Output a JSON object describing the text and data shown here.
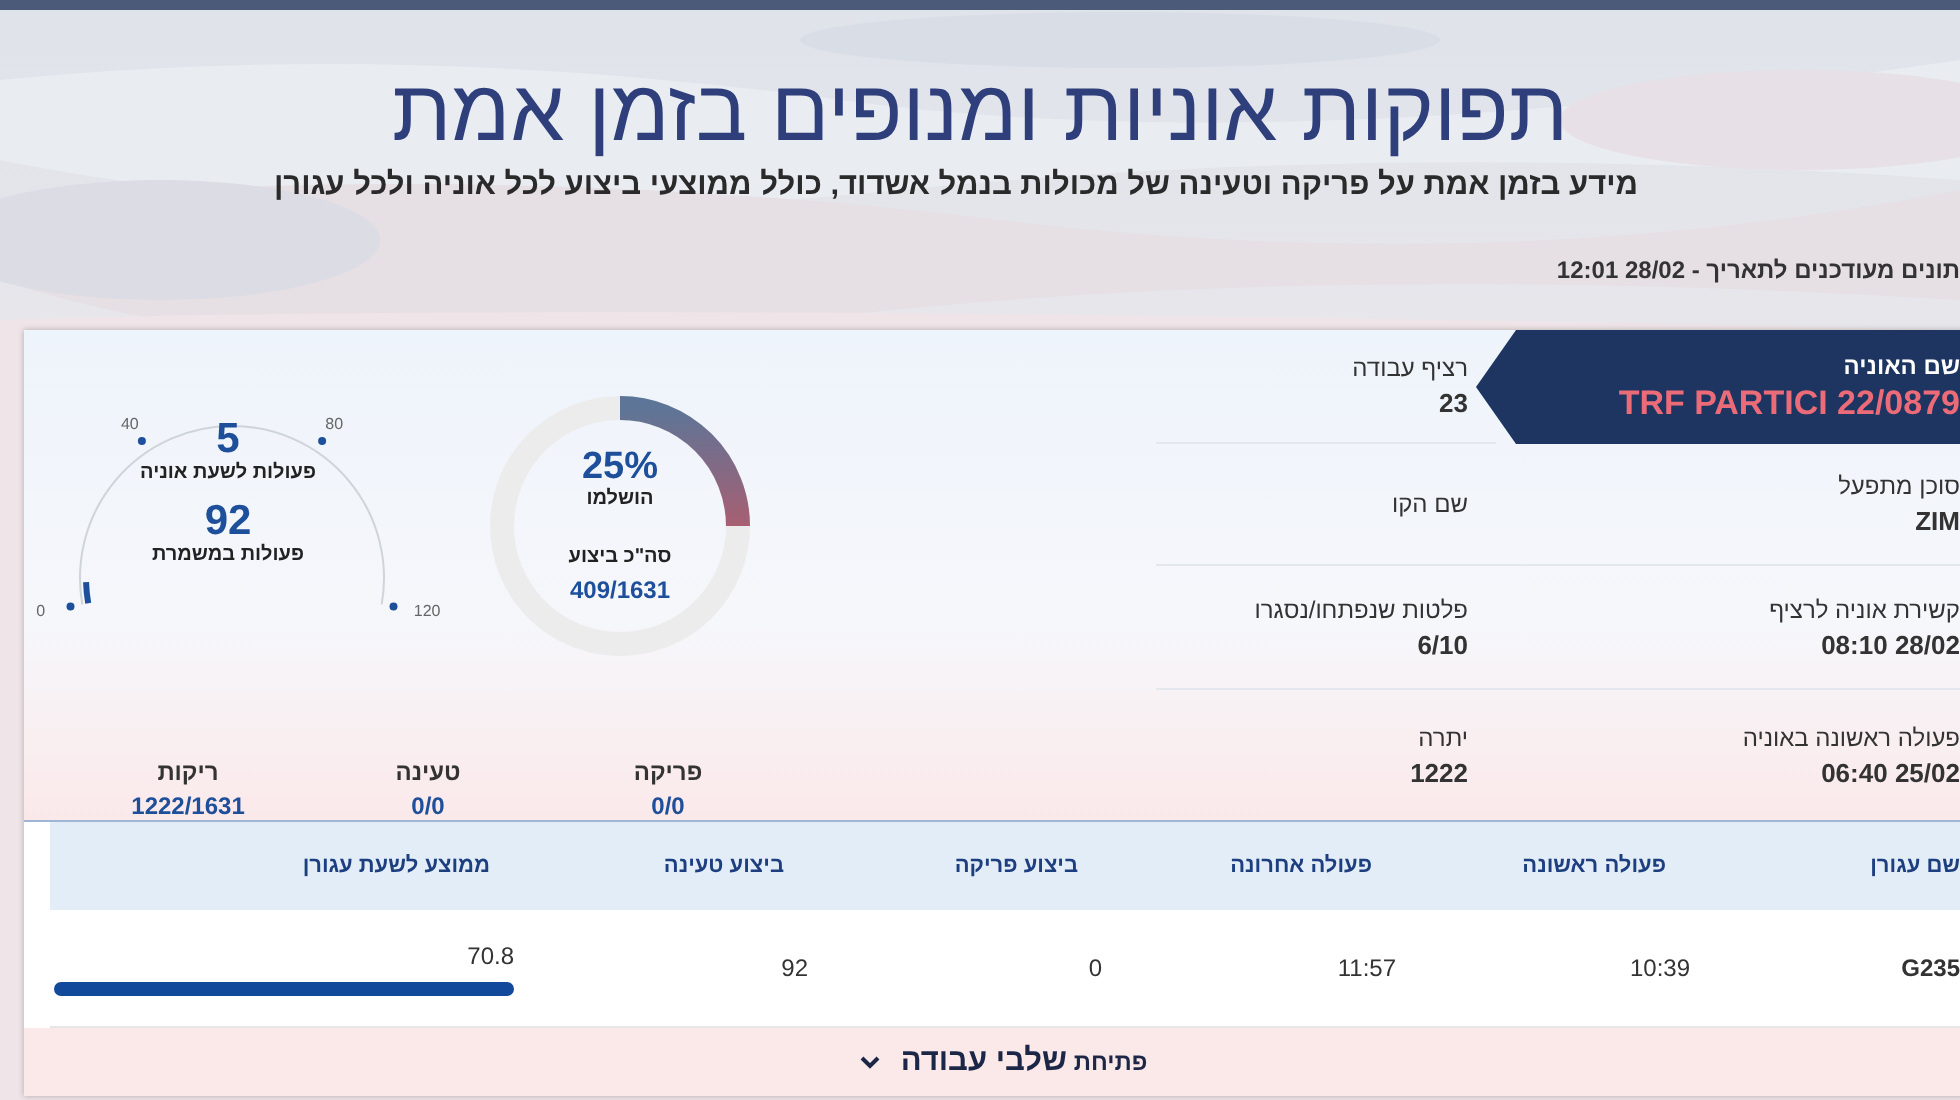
{
  "header": {
    "title": "תפוקות אוניות ומנופים בזמן אמת",
    "subtitle": "מידע בזמן אמת על פריקה וטעינה של מכולות בנמל אשדוד, כולל ממוצעי ביצוע לכל אוניה ולכל עגורן",
    "updated": "תונים מעודכנים לתאריך - 28/02 12:01"
  },
  "gauge": {
    "ticks": [
      "0",
      "40",
      "80",
      "120"
    ],
    "per_hour_value": "5",
    "per_hour_label": "פעולות לשעת אוניה",
    "shift_value": "92",
    "shift_label": "פעולות במשמרת"
  },
  "progress": {
    "percent": "25%",
    "percent_label": "הושלמו",
    "total_label": "סה\"כ ביצוע",
    "total_value": "409/1631"
  },
  "counters": [
    {
      "label": "פריקה",
      "value": "0/0"
    },
    {
      "label": "טעינה",
      "value": "0/0"
    },
    {
      "label": "ריקות",
      "value": "1222/1631"
    }
  ],
  "ship": {
    "label": "שם האוניה",
    "name": "TRF PARTICI 22/0879"
  },
  "details": [
    {
      "label": "רציף עבודה",
      "value": "23"
    },
    {
      "label": "סוכן מתפעל",
      "value": "ZIM"
    },
    {
      "label": "שם הקו"
    },
    {
      "label": "קשירת אוניה לרציף",
      "value": "28/02 08:10"
    },
    {
      "label": "פלטות שנפתחו/נסגרו",
      "value": "6/10"
    },
    {
      "label": "פעולה ראשונה באוניה",
      "value": "25/02 06:40"
    },
    {
      "label": "יתרה",
      "value": "1222"
    }
  ],
  "table": {
    "columns": [
      "שם עגורן",
      "פעולה ראשונה",
      "פעולה אחרונה",
      "ביצוע פריקה",
      "ביצוע טעינה",
      "ממוצע לשעת עגורן"
    ],
    "rows": [
      {
        "cells": [
          "G235",
          "10:39",
          "11:57",
          "0",
          "92",
          "70.8"
        ],
        "level": 1
      }
    ]
  },
  "footer": {
    "text": "פתיחת **שלבי עבודה**",
    "expanded": false
  }
}
